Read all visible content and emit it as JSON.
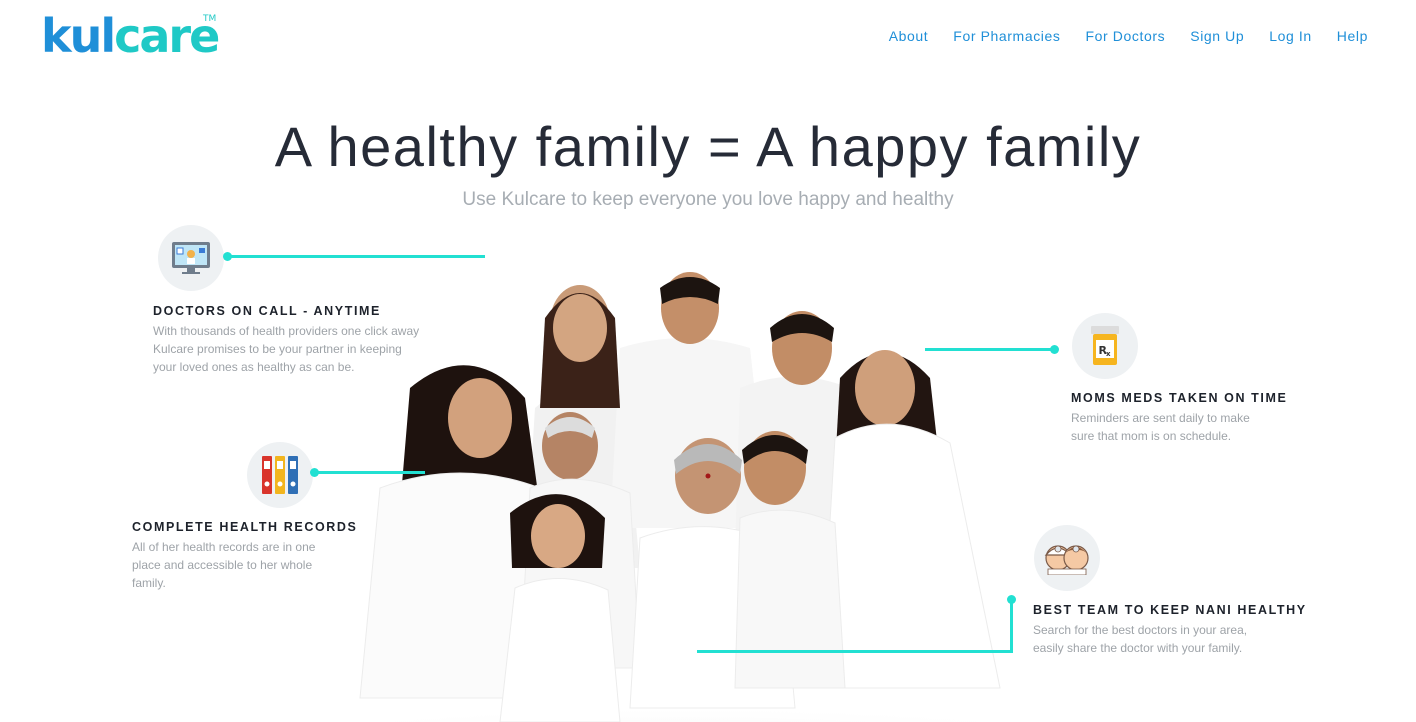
{
  "brand": {
    "logo_part1": "kul",
    "logo_part2": "care",
    "trademark": "TM"
  },
  "nav": {
    "items": [
      {
        "label": "About"
      },
      {
        "label": "For Pharmacies"
      },
      {
        "label": "For Doctors"
      },
      {
        "label": "Sign Up"
      },
      {
        "label": "Log In"
      },
      {
        "label": "Help"
      }
    ]
  },
  "hero": {
    "title": "A healthy family = A happy family",
    "subtitle": "Use Kulcare to keep everyone you love happy and healthy"
  },
  "features": [
    {
      "title": "DOCTORS ON CALL - ANYTIME",
      "description": "With thousands of health providers one click away Kulcare promises to be your partner in keeping your loved ones as healthy as can be.",
      "icon": "computer-doctor-icon"
    },
    {
      "title": "COMPLETE HEALTH RECORDS",
      "description": "All of her health records are in one place and accessible to her whole family.",
      "icon": "record-binders-icon"
    },
    {
      "title": "MOMS MEDS TAKEN ON TIME",
      "description": "Reminders are sent daily to make sure that mom is on schedule.",
      "icon": "rx-pill-bottle-icon"
    },
    {
      "title": "BEST TEAM TO KEEP NANI HEALTHY",
      "description": "Search for the best doctors in your area, easily share the doctor with your family.",
      "icon": "doctors-team-icon"
    }
  ],
  "colors": {
    "brand_blue": "#1f8fd8",
    "brand_teal": "#1fc9c6",
    "connector": "#22e0d2"
  }
}
